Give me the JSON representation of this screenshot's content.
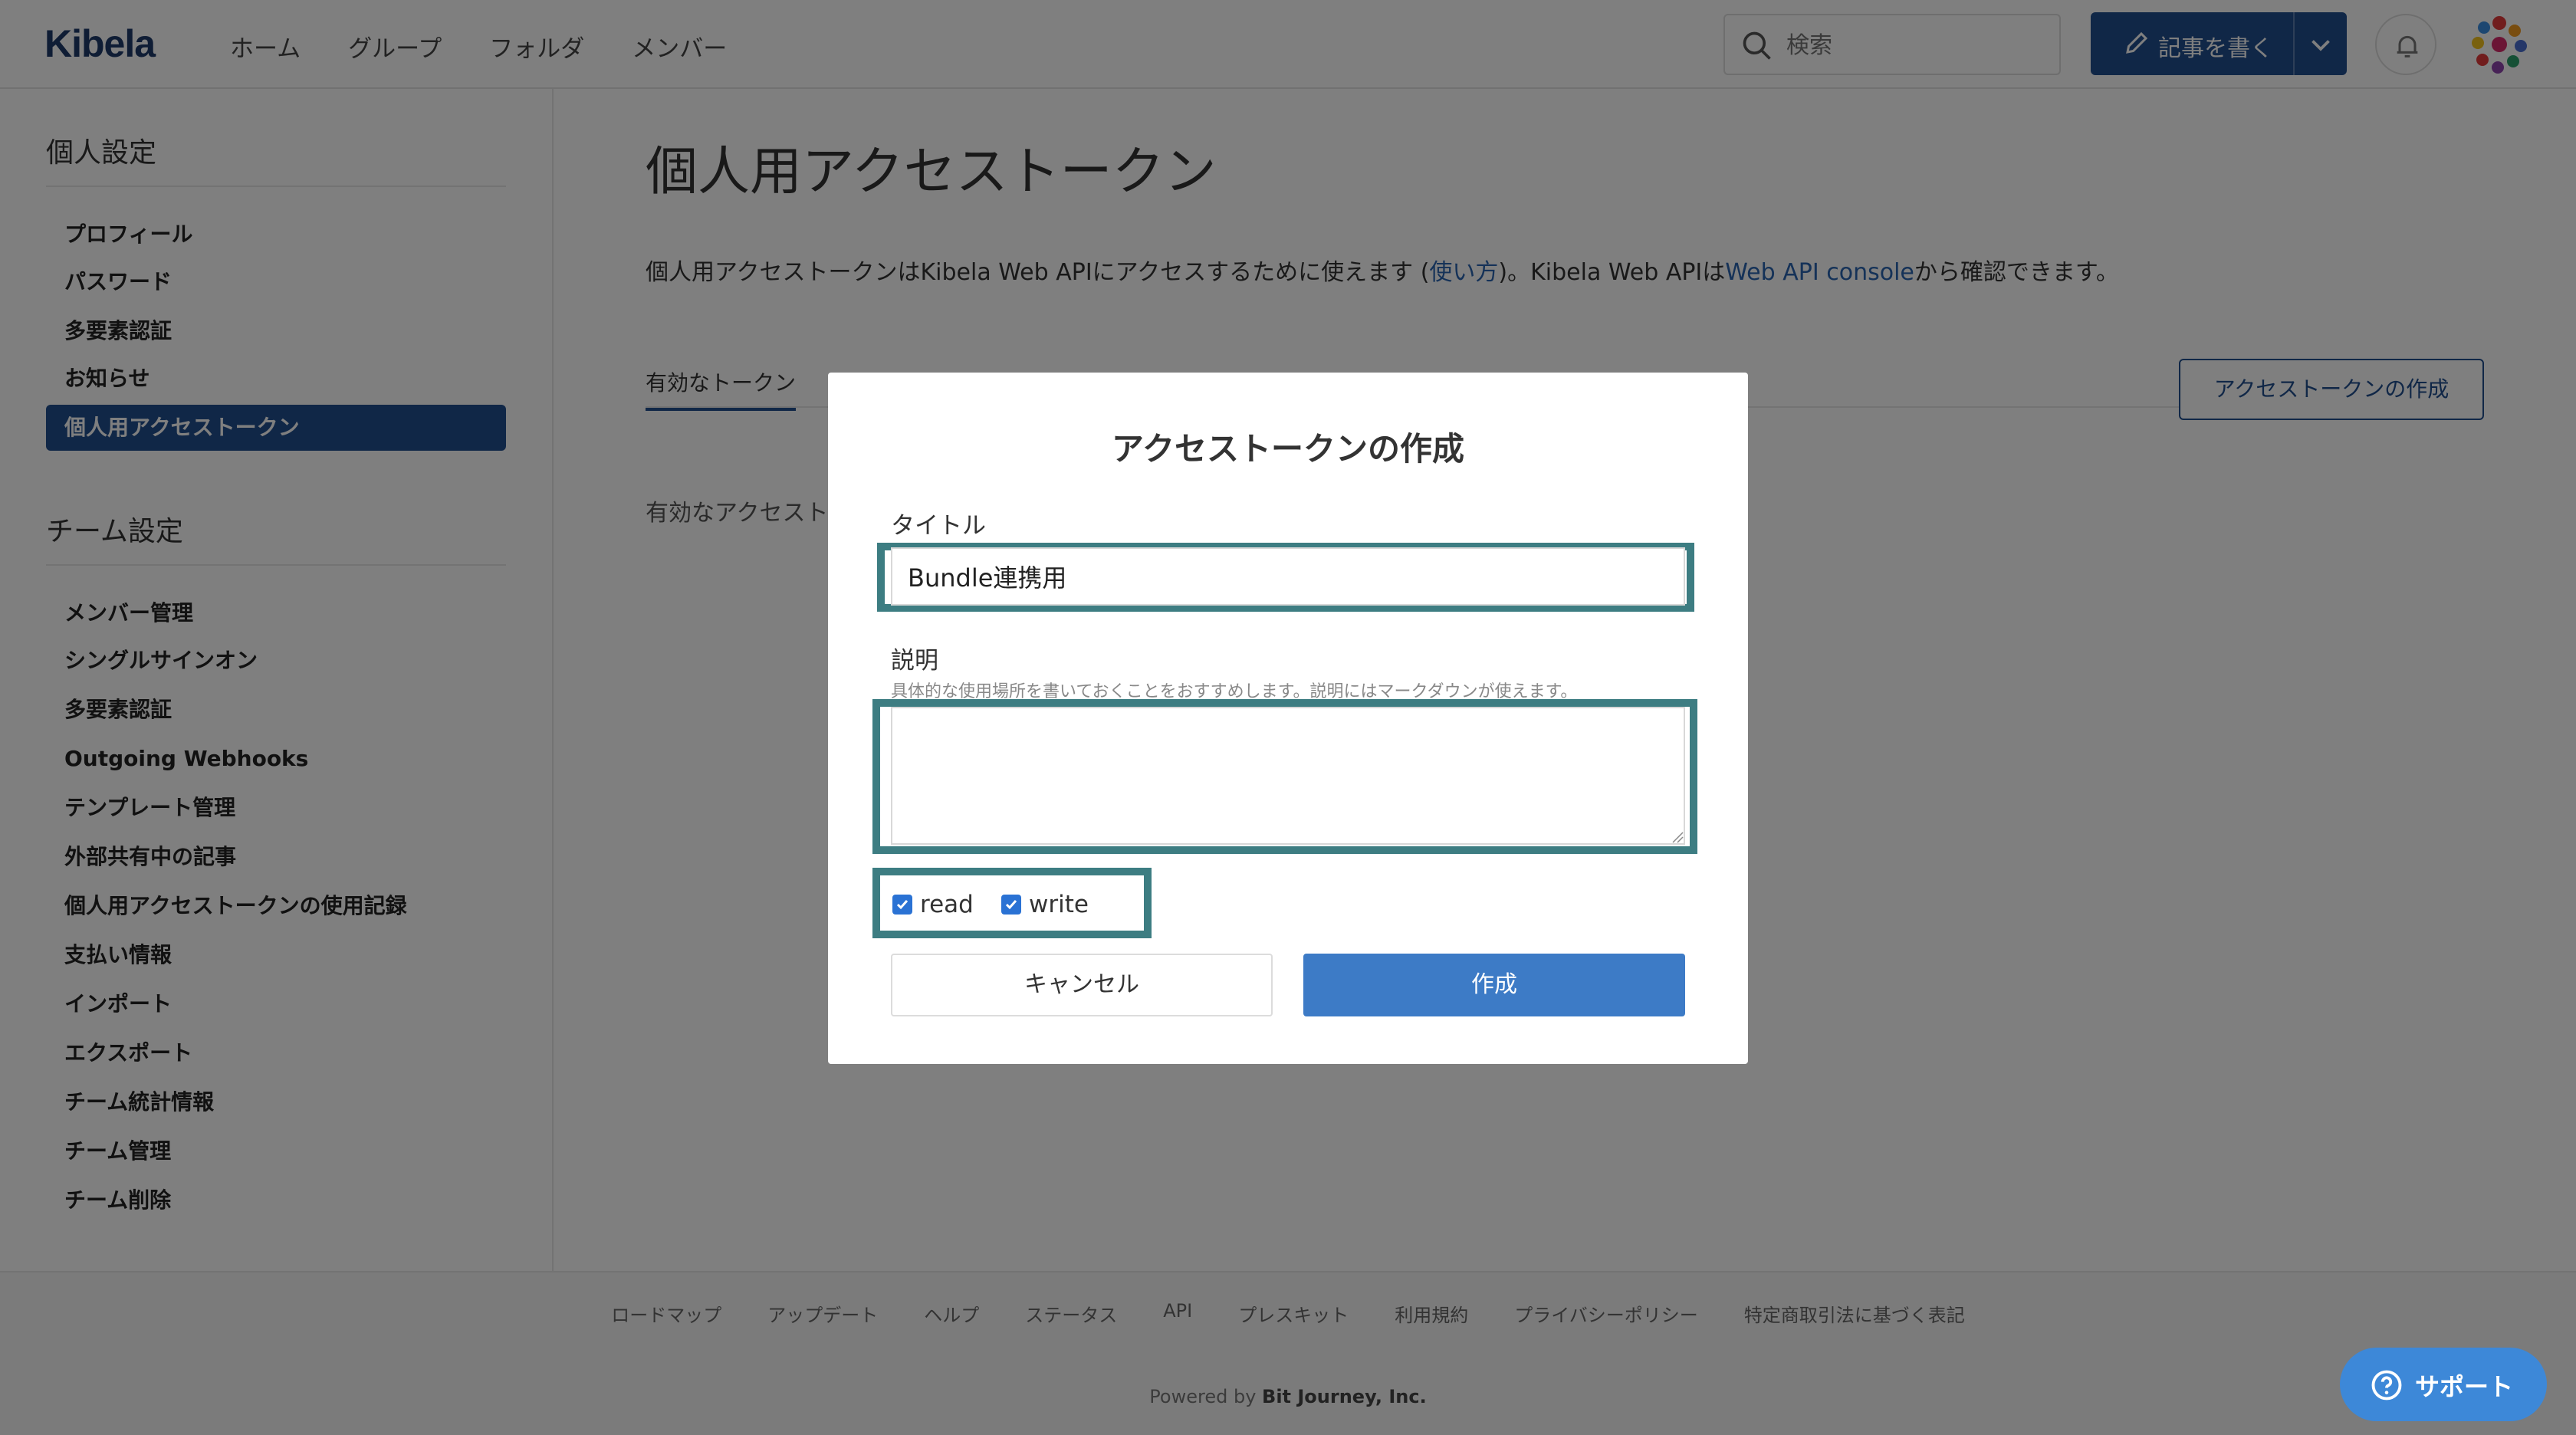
{
  "header": {
    "logo": "Kibela",
    "nav": [
      "ホーム",
      "グループ",
      "フォルダ",
      "メンバー"
    ],
    "search_placeholder": "検索",
    "write_button": "記事を書く"
  },
  "sidebar": {
    "personal_title": "個人設定",
    "personal_items": [
      "プロフィール",
      "パスワード",
      "多要素認証",
      "お知らせ",
      "個人用アクセストークン"
    ],
    "team_title": "チーム設定",
    "team_items": [
      "メンバー管理",
      "シングルサインオン",
      "多要素認証",
      "Outgoing Webhooks",
      "テンプレート管理",
      "外部共有中の記事",
      "個人用アクセストークンの使用記録",
      "支払い情報",
      "インポート",
      "エクスポート",
      "チーム統計情報",
      "チーム管理",
      "チーム削除"
    ]
  },
  "main": {
    "title": "個人用アクセストークン",
    "intro_1": "個人用アクセストークンはKibela Web APIにアクセスするために使えます (",
    "intro_link_usage": "使い方",
    "intro_2": ")。Kibela Web APIは",
    "intro_link_console": "Web API console",
    "intro_3": "から確認できます。",
    "tab_active": "有効なトークン",
    "create_button": "アクセストークンの作成",
    "empty_text": "有効なアクセスト"
  },
  "modal": {
    "title": "アクセストークンの作成",
    "title_label": "タイトル",
    "title_value": "Bundle連携用",
    "desc_label": "説明",
    "desc_hint": "具体的な使用場所を書いておくことをおすすめします。説明にはマークダウンが使えます。",
    "desc_value": "",
    "scopes": [
      {
        "label": "read",
        "checked": true
      },
      {
        "label": "write",
        "checked": true
      }
    ],
    "cancel": "キャンセル",
    "submit": "作成"
  },
  "footer": {
    "links": [
      "ロードマップ",
      "アップデート",
      "ヘルプ",
      "ステータス",
      "API",
      "プレスキット",
      "利用規約",
      "プライバシーポリシー",
      "特定商取引法に基づく表記"
    ],
    "powered_prefix": "Powered by ",
    "powered_company": "Bit Journey, Inc."
  },
  "support": {
    "label": "サポート"
  },
  "colors": {
    "brand": "#214e8e",
    "link": "#2a64b0",
    "highlight": "#3d7d82",
    "primary_button": "#3d7bc6",
    "support_button": "#3d88d8"
  }
}
